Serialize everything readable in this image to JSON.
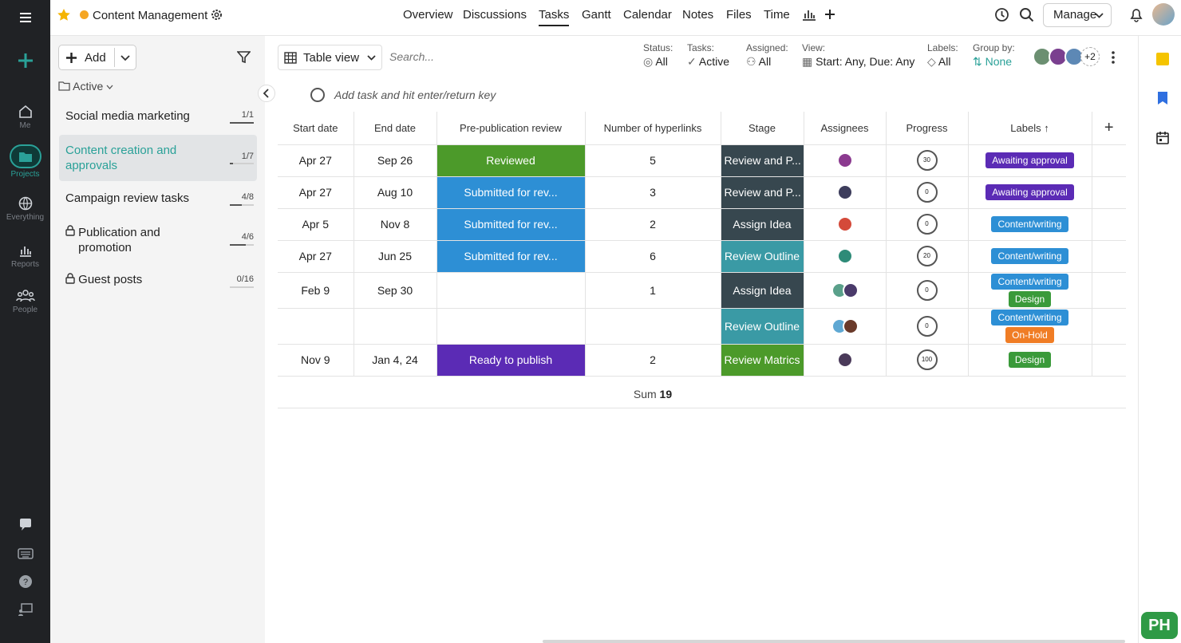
{
  "app": {
    "project_title": "Content Management",
    "project_dot_color": "#f5a623"
  },
  "nav": {
    "tabs": [
      "Overview",
      "Discussions",
      "Tasks",
      "Gantt",
      "Calendar",
      "Notes",
      "Files",
      "Time"
    ],
    "active": "Tasks",
    "manage_label": "Manage"
  },
  "rail": {
    "items": [
      {
        "label": "Me",
        "icon": "home-icon"
      },
      {
        "label": "Projects",
        "icon": "folder-icon"
      },
      {
        "label": "Everything",
        "icon": "globe-icon"
      },
      {
        "label": "Reports",
        "icon": "bar-chart-icon"
      },
      {
        "label": "People",
        "icon": "people-icon"
      }
    ]
  },
  "sidebar": {
    "add_label": "Add",
    "filter_label": "Active",
    "projects": [
      {
        "name": "Social media marketing",
        "count": "1/1",
        "progress": 1.0
      },
      {
        "name": "Content creation and approvals",
        "count": "1/7",
        "progress": 0.14
      },
      {
        "name": "Campaign review tasks",
        "count": "4/8",
        "progress": 0.5
      },
      {
        "name": "Publication and promotion",
        "count": "4/6",
        "progress": 0.67,
        "locked": true
      },
      {
        "name": "Guest posts",
        "count": "0/16",
        "progress": 0,
        "locked": true
      }
    ]
  },
  "toolbar": {
    "view_label": "Table view",
    "search_placeholder": "Search...",
    "filters": [
      {
        "label": "Status:",
        "value": "All"
      },
      {
        "label": "Tasks:",
        "value": "Active"
      },
      {
        "label": "Assigned:",
        "value": "All"
      },
      {
        "label": "View:",
        "value": "Start: Any, Due: Any"
      },
      {
        "label": "Labels:",
        "value": "All"
      },
      {
        "label": "Group by:",
        "value": "None"
      }
    ],
    "avatar_more": "+2"
  },
  "add_task_placeholder": "Add task and hit enter/return key",
  "table": {
    "headers": [
      "Start date",
      "End date",
      "Pre-publication review",
      "Number of hyperlinks",
      "Stage",
      "Assignees",
      "Progress",
      "Labels"
    ],
    "rows": [
      {
        "start": "Apr 27",
        "end": "Sep 26",
        "review": "Reviewed",
        "review_color": "#4c9a2a",
        "links": "5",
        "stage": "Review and P...",
        "stage_color": "#37474f",
        "progress": "30",
        "labels": [
          {
            "text": "Awaiting approval",
            "color": "#5b2bb5"
          }
        ]
      },
      {
        "start": "Apr 27",
        "end": "Aug 10",
        "review": "Submitted for rev...",
        "review_color": "#2d8fd5",
        "links": "3",
        "stage": "Review and P...",
        "stage_color": "#37474f",
        "progress": "0",
        "labels": [
          {
            "text": "Awaiting approval",
            "color": "#5b2bb5"
          }
        ]
      },
      {
        "start": "Apr 5",
        "end": "Nov 8",
        "review": "Submitted for rev...",
        "review_color": "#2d8fd5",
        "links": "2",
        "stage": "Assign Idea",
        "stage_color": "#37474f",
        "progress": "0",
        "labels": [
          {
            "text": "Content/writing",
            "color": "#2d8fd5"
          }
        ]
      },
      {
        "start": "Apr 27",
        "end": "Jun 25",
        "review": "Submitted for rev...",
        "review_color": "#2d8fd5",
        "links": "6",
        "stage": "Review Outline",
        "stage_color": "#3a9aa5",
        "progress": "20",
        "labels": [
          {
            "text": "Content/writing",
            "color": "#2d8fd5"
          }
        ]
      },
      {
        "start": "Feb 9",
        "end": "Sep 30",
        "review": "",
        "review_color": "",
        "links": "1",
        "stage": "Assign Idea",
        "stage_color": "#37474f",
        "progress": "0",
        "labels": [
          {
            "text": "Content/writing",
            "color": "#2d8fd5"
          },
          {
            "text": "Design",
            "color": "#3a9a3a"
          }
        ]
      },
      {
        "start": "",
        "end": "",
        "review": "",
        "review_color": "",
        "links": "",
        "stage": "Review Outline",
        "stage_color": "#3a9aa5",
        "progress": "0",
        "labels": [
          {
            "text": "Content/writing",
            "color": "#2d8fd5"
          },
          {
            "text": "On-Hold",
            "color": "#f07d25"
          }
        ]
      },
      {
        "start": "Nov 9",
        "end": "Jan 4, 24",
        "review": "Ready to publish",
        "review_color": "#5b2bb5",
        "links": "2",
        "stage": "Review Matrics",
        "stage_color": "#4c9a2a",
        "progress": "100",
        "labels": [
          {
            "text": "Design",
            "color": "#3a9a3a"
          }
        ]
      }
    ],
    "sum_label": "Sum",
    "sum_value": "19"
  },
  "colors": {
    "accent": "#2aa198",
    "rail_bg": "#202225"
  }
}
